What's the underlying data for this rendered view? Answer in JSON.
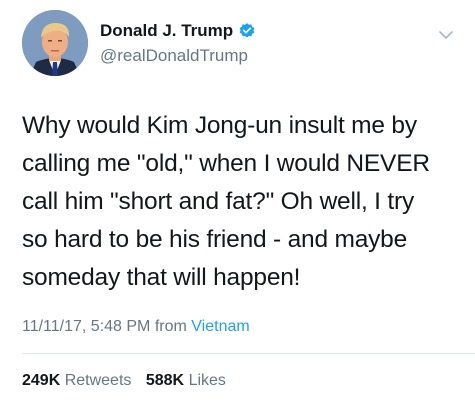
{
  "author": {
    "display_name": "Donald J. Trump",
    "handle": "@realDonaldTrump",
    "verified": true
  },
  "tweet": {
    "lines": [
      "Why would Kim Jong-un insult me by",
      "calling me \"old,\" when I would NEVER",
      "call him \"short and fat?\" Oh well, I try",
      "so hard to be his friend - and maybe",
      "someday that will happen!"
    ]
  },
  "meta": {
    "timestamp": "11/11/17, 5:48 PM",
    "from_label": "from",
    "source": "Vietnam"
  },
  "stats": {
    "retweets_count": "249K",
    "retweets_label": "Retweets",
    "likes_count": "588K",
    "likes_label": "Likes"
  },
  "colors": {
    "verified_badge": "#1da1f2",
    "link": "#1da1f2",
    "secondary_text": "#657786"
  },
  "icons": {
    "verified": "verified-badge-icon",
    "menu": "chevron-down-icon"
  }
}
